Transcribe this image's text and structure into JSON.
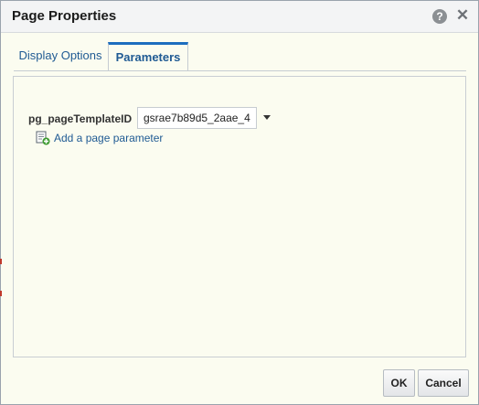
{
  "dialog": {
    "title": "Page Properties",
    "help_icon": "help-icon",
    "close_icon": "close-icon",
    "help_glyph": "?",
    "close_glyph": "✕"
  },
  "tabs": [
    {
      "label": "Display Options",
      "selected": false
    },
    {
      "label": "Parameters",
      "selected": true
    }
  ],
  "parameters": {
    "name": "pg_pageTemplateID",
    "value": "gsrae7b89d5_2aae_4",
    "add_link": "Add a page parameter",
    "add_icon": "add-page-parameter-icon"
  },
  "buttons": {
    "ok": "OK",
    "cancel": "Cancel"
  },
  "colors": {
    "accent": "#1d6ebf",
    "link": "#1f5a93",
    "panel_background": "#fbfcf0"
  }
}
